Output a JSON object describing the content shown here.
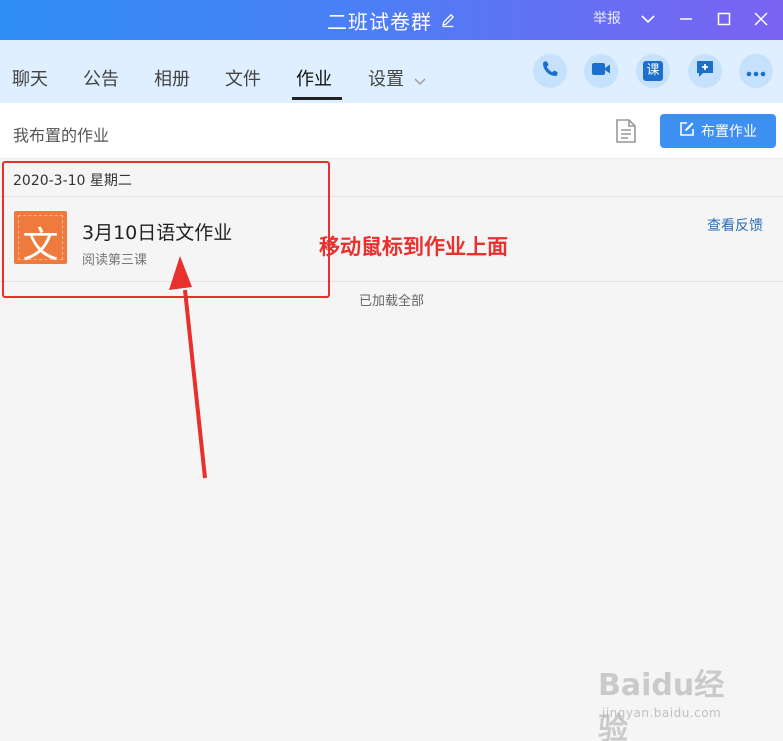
{
  "window": {
    "title": "二班试卷群",
    "report_label": "举报"
  },
  "tabs": [
    {
      "label": "聊天"
    },
    {
      "label": "公告"
    },
    {
      "label": "相册"
    },
    {
      "label": "文件"
    },
    {
      "label": "作业",
      "active": true
    },
    {
      "label": "设置"
    }
  ],
  "toolbar_icons": [
    "phone-icon",
    "video-call-icon",
    "lesson-icon",
    "add-chat-icon",
    "more-icon"
  ],
  "lesson_icon_char": "课",
  "header": {
    "title": "我布置的作业",
    "assign_button": "布置作业"
  },
  "homework": {
    "date": "2020-3-10 星期二",
    "items": [
      {
        "subject_char": "文",
        "title": "3月10日语文作业",
        "subtitle": "阅读第三课",
        "action": "查看反馈"
      }
    ],
    "loaded_text": "已加载全部"
  },
  "annotation": {
    "text": "移动鼠标到作业上面",
    "color": "#e8302d"
  },
  "watermark": {
    "logo": "Baidu经验",
    "url": "jingyan.baidu.com"
  },
  "colors": {
    "accent": "#3d8ff2",
    "subject_icon": "#ef7a3d",
    "link": "#2a6fb5"
  }
}
